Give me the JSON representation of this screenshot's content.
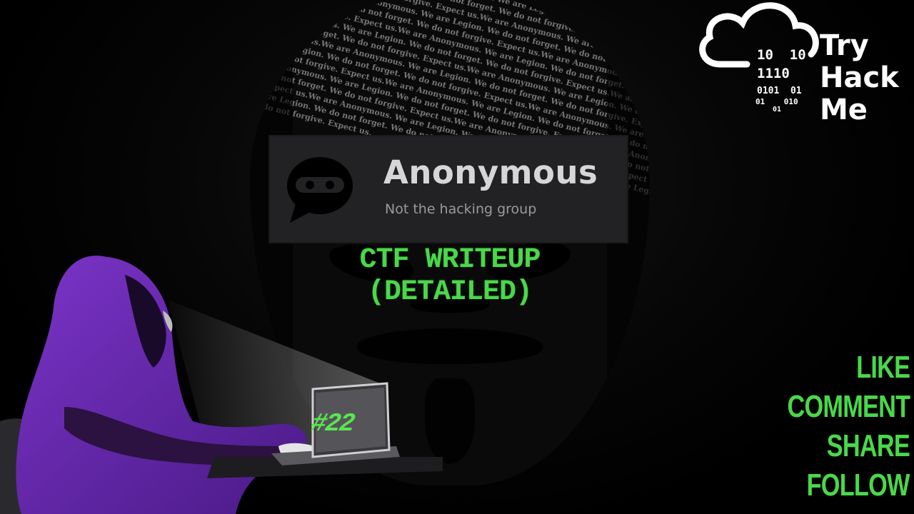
{
  "background": {
    "mask_text": "We do not forgive. Expect us.We are Anonymous. We are Legion. We do not forget. We do not forgive. Expect us.We are Anonymous. We are Legion. We do not forget. We do not forgive. Expect us.We are Anonymous. We are Legion. We do not forget. We do not forgive. Expect us.We are Anonymous. We are Legion. We do not forget. We do not forgive. Expect us.We are Anonymous. We are Legion. We do not forget. We do not forgive. Expect us.We are Anonymous. We are Legion. We do not forget. We do not forgive. Expect us.We are Anonymous. We are Legion. We do not forget. We do not forgive. Expect us.We are Anonymous. We are Legion. We do not forget. We do not forgive. Expect us.We are Anonymous. We are Legion. We do not forget. We do not forgive. Expect us.We are Anonymous. We are Legion. We do not forget. We do not forgive. Expect us.We are Anonymous. We are Legion. We do not forget. We do not forgive. Expect us.We are Anonymous. We are Legion. We do not forget. We do not forgive. Expect us.We are Anonymous. We are Legion. We do not forget. We do not forgive. Expect us.We are Anonymous. We are Legion. We do not forget. We do not forgive. Expect us.We are Anonymous. We are Legion. We do not forget. We do not forgive. Expect us.We are Anonymous. We are Legion. We do not forget. We do not forgive. Expect us.We are Anonymous. We are Legion. We do not forget. We do not forgive. Expect us.We are Anonymous. We are Legion. We do not forget. We do not forgive. Expect us.We are Anonymous. We are Legion. We do not forget. We do not forgive. Expect us.We are Anonymous. We are Legion. We do not forget. We do not forgive. Expect us.We are Anonymous. We are Legion. We do not forget. We do not forgive. Expect us.We are Anonymous. We are Legion. We do not forget. We do not forgive. Expect us.We are Anonymous. We are Legion. We do not forget. We do not forgive. Expect us.We are Anonymous. We are Legion. We do not forget. We do not forgive. Expect us."
  },
  "logo": {
    "title": "Anonymous",
    "subtitle": "Not the hacking group",
    "icon": "ninja-chat-bubble-icon"
  },
  "ctf_title": "CTF WRITEUP (DETAILED)",
  "episode_badge": "#22",
  "brand": {
    "icon": "cloud-binary-icon",
    "binary_lines": [
      "10  10",
      "1110",
      "0101  01",
      "01    010",
      "01"
    ],
    "words": [
      "Try",
      "Hack",
      "Me"
    ]
  },
  "cta": [
    "LIKE",
    "COMMENT",
    "SHARE",
    "FOLLOW"
  ],
  "colors": {
    "accent_green": "#49d84a",
    "hood_purple": "#6a2bb0",
    "logo_bg": "#222224"
  }
}
